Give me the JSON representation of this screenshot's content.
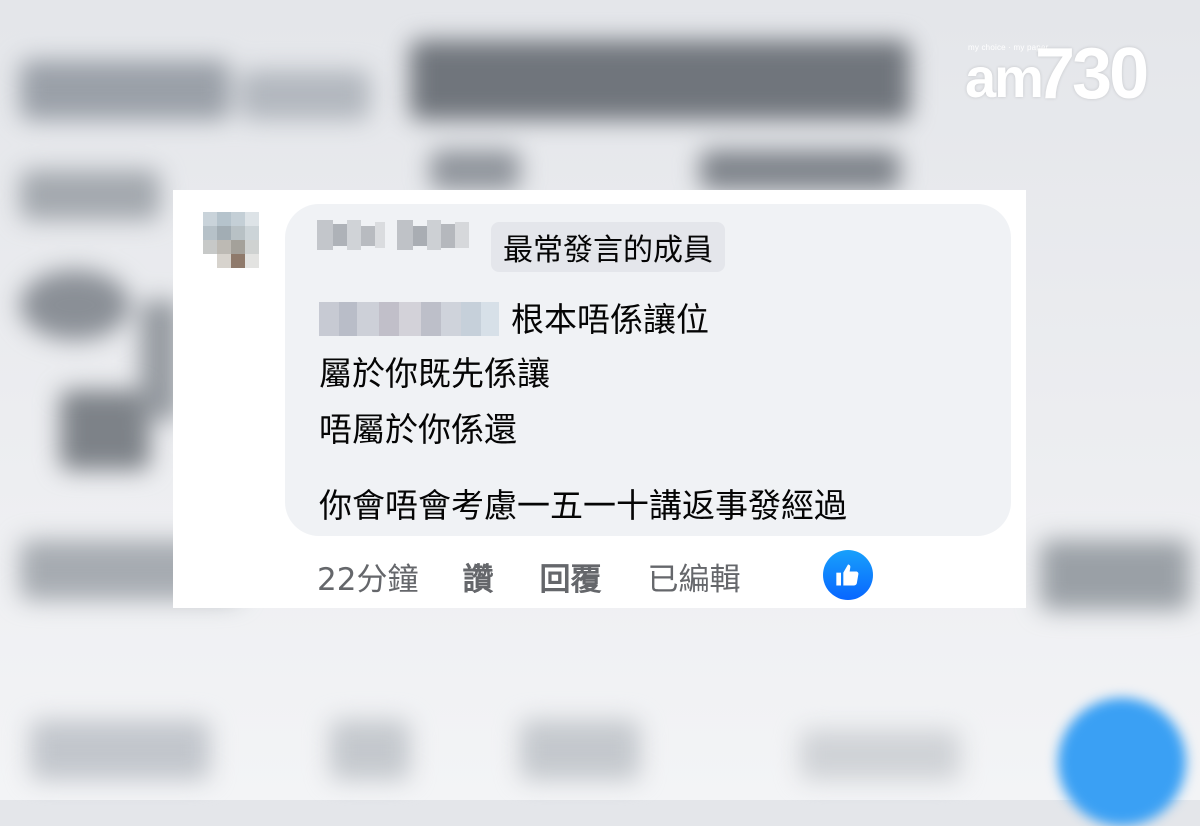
{
  "logo": {
    "tagline": "my choice · my paper",
    "brand_letters": "am",
    "brand_number": "730"
  },
  "comment": {
    "badge": "最常發言的成員",
    "lines": [
      "根本唔係讓位",
      "屬於你既先係讓",
      "唔屬於你係還",
      "你會唔會考慮一五一十講返事發經過"
    ],
    "actions": {
      "time": "22分鐘",
      "like": "讚",
      "reply": "回覆",
      "edited": "已編輯"
    },
    "reaction": "like-icon"
  },
  "colors": {
    "bubble": "#f0f2f5",
    "badge": "#e4e6eb",
    "like_blue": "#0866ff",
    "meta_gray": "#65676b"
  }
}
